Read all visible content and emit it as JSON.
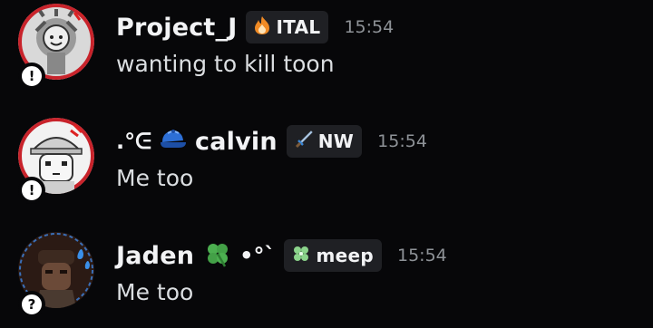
{
  "messages": [
    {
      "username": "Project_J",
      "tag": {
        "icon": "fire-icon",
        "label": "ITAL"
      },
      "timestamp": "15:54",
      "content": "wanting to kill toon",
      "status_badge": "!"
    },
    {
      "prefix_deco": ".°ᕮ",
      "username_icon": "blue-cap-icon",
      "username": "calvin",
      "tag": {
        "icon": "sword-icon",
        "label": "NW"
      },
      "timestamp": "15:54",
      "content": "Me too",
      "status_badge": "!"
    },
    {
      "username": "Jaden",
      "username_icon": "four-leaf-clover-icon",
      "suffix_deco": "•°`",
      "tag": {
        "icon": "clover-icon",
        "label": "meep"
      },
      "timestamp": "15:54",
      "content": "Me too",
      "status_badge": "?"
    }
  ],
  "colors": {
    "background": "#070709",
    "username": "#f2f3f5",
    "text": "#dbdee1",
    "timestamp": "#8e9297",
    "tag_background": "#1f2024"
  }
}
